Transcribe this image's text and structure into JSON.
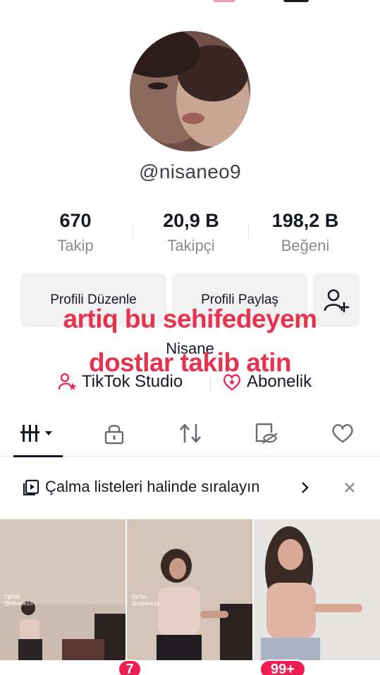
{
  "profile": {
    "username": "@nisaneo9",
    "name": "Nisane"
  },
  "stats": [
    {
      "value": "670",
      "label": "Takip"
    },
    {
      "value": "20,9 B",
      "label": "Takipçi"
    },
    {
      "value": "198,2 B",
      "label": "Beğeni"
    }
  ],
  "actions": {
    "edit_label": "Profili Düzenle",
    "share_label": "Profili Paylaş"
  },
  "links": {
    "studio_label": "TikTok Studio",
    "subscription_label": "Abonelik"
  },
  "overlay": {
    "line1": "artiq bu sehifedeyem",
    "line2": "dostlar takib atin",
    "color": "#e6334f"
  },
  "tabs": [
    "videos-grid-icon",
    "lock-icon",
    "repost-icon",
    "hidden-eye-icon",
    "heart-icon"
  ],
  "playlist_banner": {
    "text": "Çalma listeleri halinde sıralayın"
  },
  "thumbnails": [
    {
      "watermark": "TikTok\n@nisane15"
    },
    {
      "watermark": "TikTok\n@nisane15"
    },
    {
      "watermark": ""
    }
  ],
  "bottom_nav": {
    "inbox_badge": "7",
    "notif_badge": "99+"
  },
  "colors": {
    "accent": "#ee1d52",
    "text": "#161823",
    "secondary_text": "#8a8b91",
    "button_bg": "#f1f1f2"
  }
}
